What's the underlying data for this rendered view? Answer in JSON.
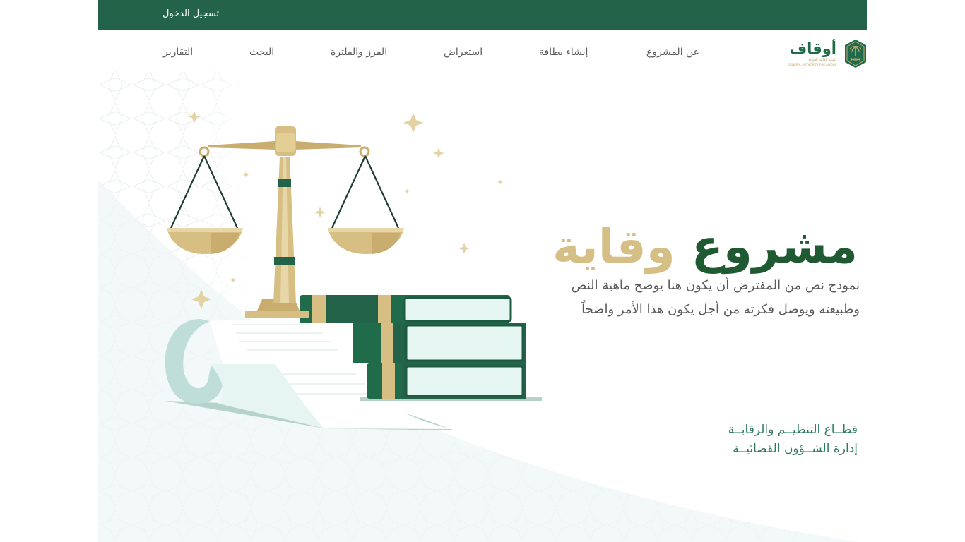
{
  "header": {
    "login_label": "تسجيل الدخول",
    "background_color": "#23634a"
  },
  "nav": {
    "items": [
      "عن المشروع",
      "إنشاء بطاقة",
      "استعراض",
      "الفرز والفلترة",
      "البحث",
      "التقارير"
    ]
  },
  "logo": {
    "name": "أوقاف",
    "subtitle": "الهيئة العامة للأوقاف",
    "subtitle_en": "GENERAL AUTHORITY FOR AWQAF",
    "icon": "palm-swords-emblem-icon"
  },
  "hero": {
    "title_part1": "مشروع",
    "title_part2": "وقاية",
    "description": "نموذج نص من المفترض أن يكون هنا يوضح ماهية النص وطبيعته ويوصل فكرته من أجل يكون هذا الأمر واضحاً",
    "sector_line1": "قطــاع التنظيــم والرقابــة",
    "sector_line2": "إدارة الشــؤون القضائيــة",
    "illustration": "scales-of-justice-books-scroll-icon"
  },
  "colors": {
    "primary_green": "#23634a",
    "title_green": "#1f5a32",
    "gold": "#d5bf84",
    "text_gray": "#5a5a5a",
    "sector_green": "#2f7a5c"
  }
}
